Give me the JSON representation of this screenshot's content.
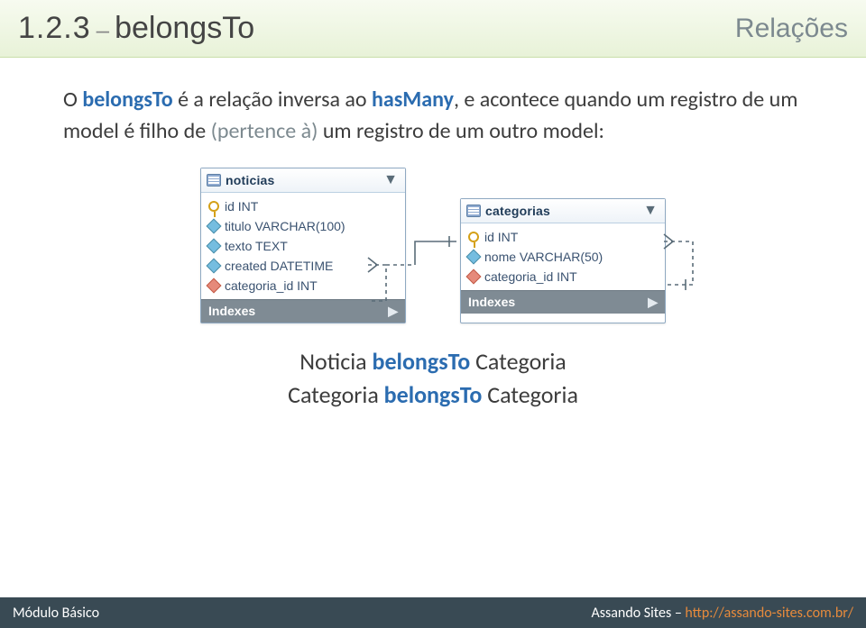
{
  "header": {
    "section_number": "1.2.3",
    "separator": "–",
    "title": "belongsTo",
    "category": "Relações"
  },
  "paragraph": {
    "t0": "O ",
    "kw_belongsTo": "belongsTo",
    "t1": " é a relação inversa ao ",
    "kw_hasMany": "hasMany",
    "t2": ", e acontece quando um registro de um model é filho de ",
    "phrase_pertence": "(pertence à)",
    "t3": " um registro de um outro model:"
  },
  "tables": {
    "noticias": {
      "name": "noticias",
      "columns": [
        {
          "icon": "key",
          "label": "id INT"
        },
        {
          "icon": "dia",
          "label": "titulo VARCHAR(100)"
        },
        {
          "icon": "dia",
          "label": "texto TEXT"
        },
        {
          "icon": "dia",
          "label": "created DATETIME"
        },
        {
          "icon": "dia-red",
          "label": "categoria_id INT"
        }
      ],
      "footer": "Indexes"
    },
    "categorias": {
      "name": "categorias",
      "columns": [
        {
          "icon": "key",
          "label": "id INT"
        },
        {
          "icon": "dia",
          "label": "nome VARCHAR(50)"
        },
        {
          "icon": "dia-red",
          "label": "categoria_id INT"
        }
      ],
      "footer": "Indexes"
    }
  },
  "statements": {
    "s1_a": "Noticia ",
    "s1_b": "belongsTo",
    "s1_c": " Categoria",
    "s2_a": "Categoria ",
    "s2_b": "belongsTo",
    "s2_c": " Categoria"
  },
  "footer": {
    "left": "Módulo Básico",
    "right_label": "Assando Sites – ",
    "right_url_text": "http://assando-sites.com.br/"
  }
}
